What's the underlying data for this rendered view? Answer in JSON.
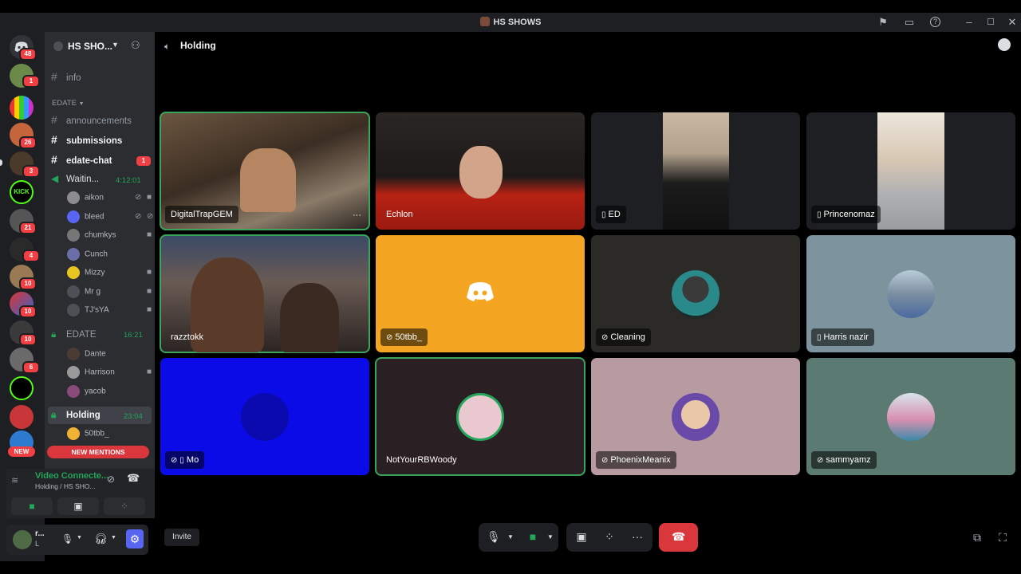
{
  "window": {
    "title": "HS SHOWS"
  },
  "server": {
    "name": "HS SHO..."
  },
  "rail": {
    "badges": [
      "48",
      "1",
      "26",
      "3",
      "21",
      "4",
      "10",
      "10",
      "10",
      "6"
    ],
    "new_label": "NEW"
  },
  "channels": {
    "info": "info",
    "category": "EDATE",
    "announcements": "announcements",
    "submissions": "submissions",
    "edate_chat": "edate-chat",
    "edate_chat_badge": "1",
    "waiting": {
      "name": "Waitin...",
      "timer": "4:12:01",
      "users": [
        "aikon",
        "bleed",
        "chumkys",
        "Cunch",
        "Mizzy",
        "Mr g",
        "TJ'sYA"
      ]
    },
    "edate_voice": {
      "name": "EDATE",
      "timer": "16:21",
      "users": [
        "Dante",
        "Harrison",
        "yacob"
      ]
    },
    "holding": {
      "name": "Holding",
      "timer": "23:04",
      "users": [
        "50tbb_"
      ]
    },
    "new_mentions": "NEW MENTIONS"
  },
  "voice_panel": {
    "status": "Video Connecte...",
    "location": "Holding / HS SHO..."
  },
  "user_panel": {
    "name": "r...",
    "status": "L"
  },
  "header": {
    "channel": "Holding"
  },
  "tiles": [
    "DigitalTrapGEM",
    "Echlon",
    "ED",
    "Princenomaz",
    "razztokk",
    "50tbb_",
    "Cleaning",
    "Harris nazir",
    "Mo",
    "NotYourRBWoody",
    "PhoenixMeanix",
    "sammyamz"
  ],
  "controls": {
    "invite": "Invite"
  },
  "colors": {
    "accent": "#5865f2",
    "speaking": "#3ba55d",
    "danger": "#da373c",
    "orange_tile": "#f4a623",
    "blue_tile": "#0b0be8"
  }
}
